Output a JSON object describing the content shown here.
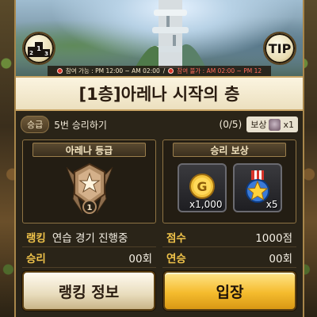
{
  "schedule": {
    "available_label": "참여 가능 : PM 12:00 ~ AM 02:00",
    "separator": "/",
    "unavailable_label": "참여 불가 : AM 02:00 ~ PM 12"
  },
  "tip_label": "TIP",
  "title": "[1층]아레나 시작의 층",
  "mission": {
    "badge": "승급",
    "text": "5번 승리하기",
    "progress": "(0/5)",
    "reward_label": "보상",
    "reward_qty": "x1"
  },
  "grade_box": {
    "header": "아레나 등급",
    "rank_number": "1"
  },
  "reward_box": {
    "header": "승리 보상",
    "items": [
      {
        "icon": "gold-coin-icon",
        "qty": "x1,000"
      },
      {
        "icon": "star-medal-icon",
        "qty": "x5"
      }
    ]
  },
  "stats": {
    "rank_label": "랭킹",
    "rank_value": "연습 경기 진행중",
    "score_label": "점수",
    "score_value": "1000점",
    "wins_label": "승리",
    "wins_value": "00회",
    "streak_label": "연승",
    "streak_value": "00회"
  },
  "buttons": {
    "ranking_info": "랭킹 정보",
    "enter": "입장"
  },
  "colors": {
    "panel_bg": "#2a2418",
    "gold_text": "#f0c34a",
    "enter_button": "#f5bc2e",
    "border_gold": "#a8864a"
  }
}
